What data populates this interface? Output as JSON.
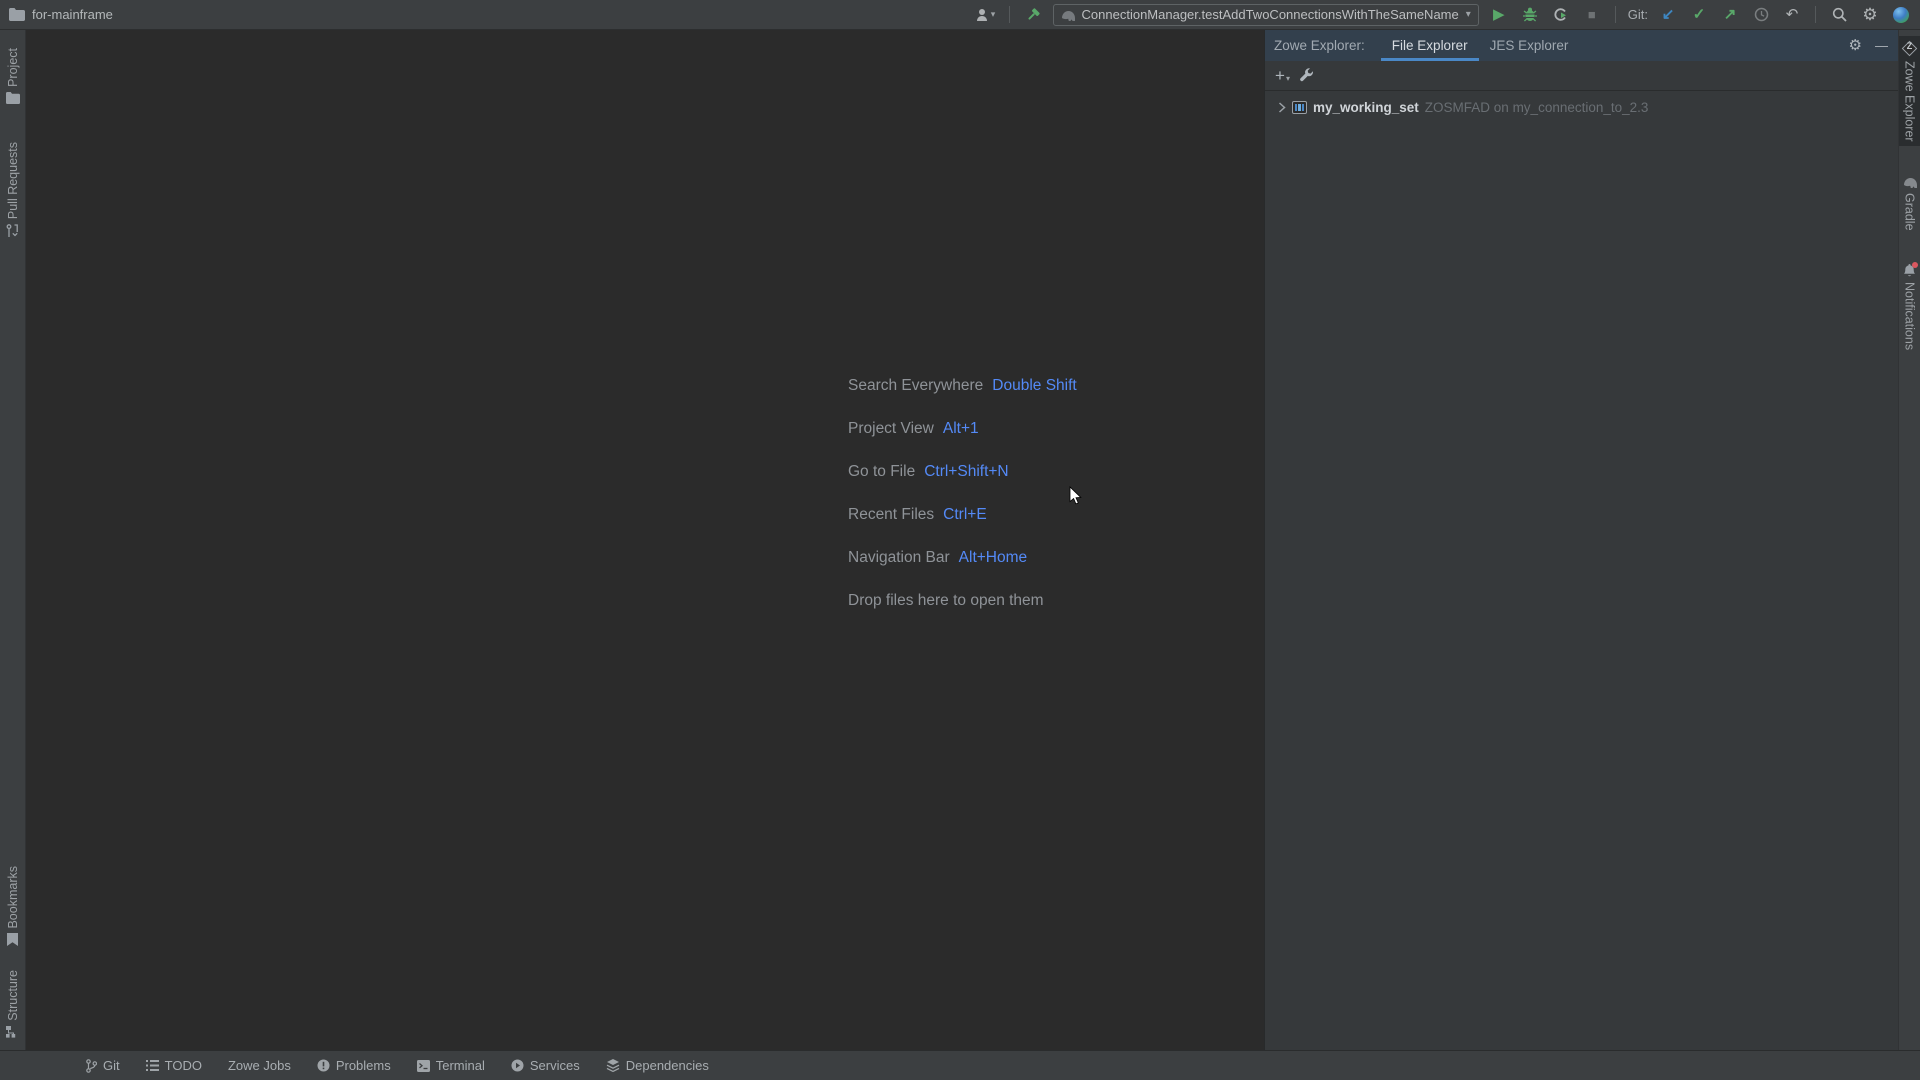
{
  "title_bar": {
    "project_name": "for-mainframe"
  },
  "toolbar": {
    "run_config": "ConnectionManager.testAddTwoConnectionsWithTheSameName",
    "git_label": "Git:"
  },
  "icons": {
    "caret_down": "▾",
    "plus": "+",
    "gear": "⚙",
    "minimize": "—",
    "run": "▶",
    "stop": "■",
    "git_update": "↙",
    "git_commit": "✓",
    "git_push": "↗",
    "git_rollback": "↶",
    "zowe_letter": "Z"
  },
  "left_stripe": {
    "top": [
      {
        "label": "Project"
      },
      {
        "label": "Pull Requests"
      }
    ],
    "bottom": [
      {
        "label": "Bookmarks"
      },
      {
        "label": "Structure"
      }
    ]
  },
  "right_stripe": {
    "items": [
      {
        "label": "Zowe Explorer"
      },
      {
        "label": "Gradle"
      },
      {
        "label": "Notifications"
      }
    ]
  },
  "editor": {
    "shortcuts": [
      {
        "label": "Search Everywhere",
        "keys": "Double Shift"
      },
      {
        "label": "Project View",
        "keys": "Alt+1"
      },
      {
        "label": "Go to File",
        "keys": "Ctrl+Shift+N"
      },
      {
        "label": "Recent Files",
        "keys": "Ctrl+E"
      },
      {
        "label": "Navigation Bar",
        "keys": "Alt+Home"
      }
    ],
    "drop_hint": "Drop files here to open them"
  },
  "tool_window": {
    "title": "Zowe Explorer:",
    "tabs": [
      {
        "label": "File Explorer"
      },
      {
        "label": "JES Explorer"
      }
    ],
    "active_tab": "File Explorer",
    "tree": [
      {
        "name": "my_working_set",
        "detail": "ZOSMFAD on my_connection_to_2.3"
      }
    ]
  },
  "status_bar": {
    "items": [
      {
        "label": "Git"
      },
      {
        "label": "TODO"
      },
      {
        "label": "Zowe Jobs"
      },
      {
        "label": "Problems"
      },
      {
        "label": "Terminal"
      },
      {
        "label": "Services"
      },
      {
        "label": "Dependencies"
      }
    ]
  },
  "colors": {
    "accent_blue": "#4A88C7",
    "shortcut_blue": "#548AF7",
    "run_green": "#59A869",
    "notification_red": "#DB5860",
    "panel_bg": "#3C3F41",
    "editor_bg": "#2B2B2B",
    "header_bg": "#33404D"
  }
}
